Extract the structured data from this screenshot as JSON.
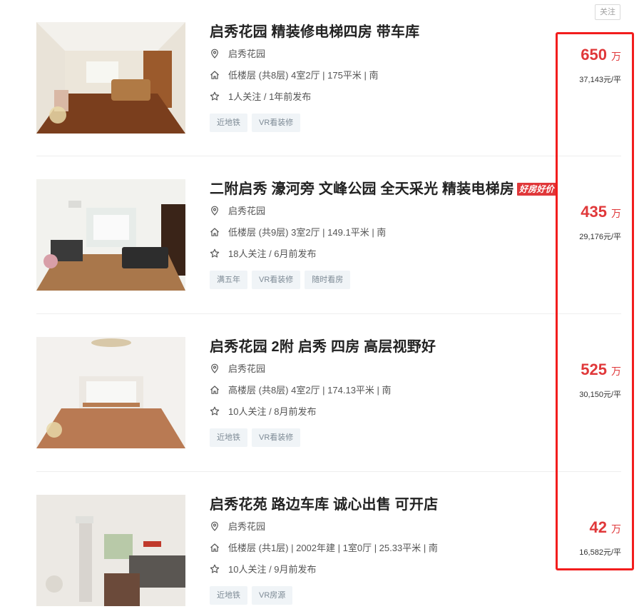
{
  "follow_button": {
    "label": "关注"
  },
  "listings": [
    {
      "title": "启秀花园 精装修电梯四房 带车库",
      "badge": "",
      "community": "启秀花园",
      "house_info": "低楼层 (共8层) 4室2厅 | 175平米 | 南",
      "follow_info": "1人关注 / 1年前发布",
      "tags": [
        "近地铁",
        "VR看装修"
      ],
      "price": "650",
      "price_unit": "万",
      "unit_price": "37,143元/平"
    },
    {
      "title": "二附启秀 濠河旁 文峰公园 全天采光 精装电梯房",
      "badge": "好房好价",
      "community": "启秀花园",
      "house_info": "低楼层 (共9层) 3室2厅 | 149.1平米 | 南",
      "follow_info": "18人关注 / 6月前发布",
      "tags": [
        "满五年",
        "VR看装修",
        "随时看房"
      ],
      "price": "435",
      "price_unit": "万",
      "unit_price": "29,176元/平"
    },
    {
      "title": "启秀花园 2附 启秀 四房 高层视野好",
      "badge": "",
      "community": "启秀花园",
      "house_info": "高楼层 (共8层) 4室2厅 | 174.13平米 | 南",
      "follow_info": "10人关注 / 8月前发布",
      "tags": [
        "近地铁",
        "VR看装修"
      ],
      "price": "525",
      "price_unit": "万",
      "unit_price": "30,150元/平"
    },
    {
      "title": "启秀花苑 路边车库 诚心出售 可开店",
      "badge": "",
      "community": "启秀花园",
      "house_info": "低楼层 (共1层) | 2002年建 | 1室0厅 | 25.33平米 | 南",
      "follow_info": "10人关注 / 9月前发布",
      "tags": [
        "近地铁",
        "VR房源"
      ],
      "price": "42",
      "price_unit": "万",
      "unit_price": "16,582元/平"
    }
  ],
  "icons": {
    "community": "location-pin-icon",
    "house_info": "home-icon",
    "follow_info": "star-icon"
  },
  "colors": {
    "price_red": "#e0383a",
    "highlight_border": "#f21d1d",
    "tag_bg": "#f0f4f7",
    "tag_text": "#7d8a95"
  }
}
